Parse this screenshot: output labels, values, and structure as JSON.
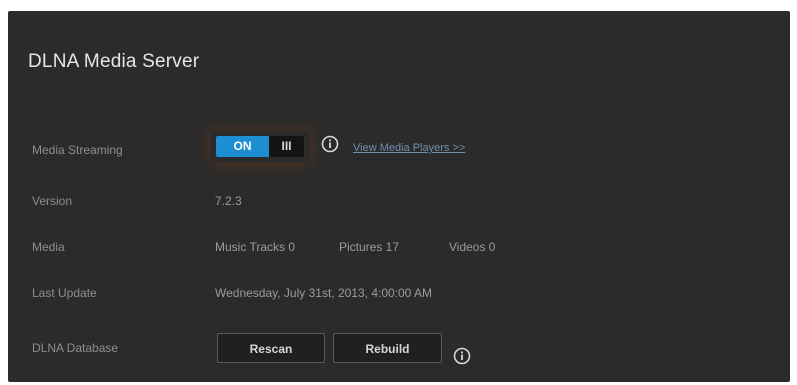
{
  "panel": {
    "title": "DLNA Media Server"
  },
  "rows": {
    "streaming": {
      "label": "Media Streaming",
      "toggle_on_label": "ON",
      "toggle_off_label": "III",
      "state": "on",
      "link_text": "View Media Players >>"
    },
    "version": {
      "label": "Version",
      "value": "7.2.3"
    },
    "media": {
      "label": "Media",
      "music": "Music Tracks 0",
      "pictures": "Pictures 17",
      "videos": "Videos 0"
    },
    "last_update": {
      "label": "Last Update",
      "value": "Wednesday, July 31st, 2013, 4:00:00 AM"
    },
    "database": {
      "label": "DLNA Database",
      "rescan_label": "Rescan",
      "rebuild_label": "Rebuild"
    }
  },
  "icons": {
    "info": "info-icon"
  },
  "colors": {
    "accent": "#1c8ed1",
    "panel_bg": "#2b2b2b",
    "link": "#6f8fb0"
  }
}
